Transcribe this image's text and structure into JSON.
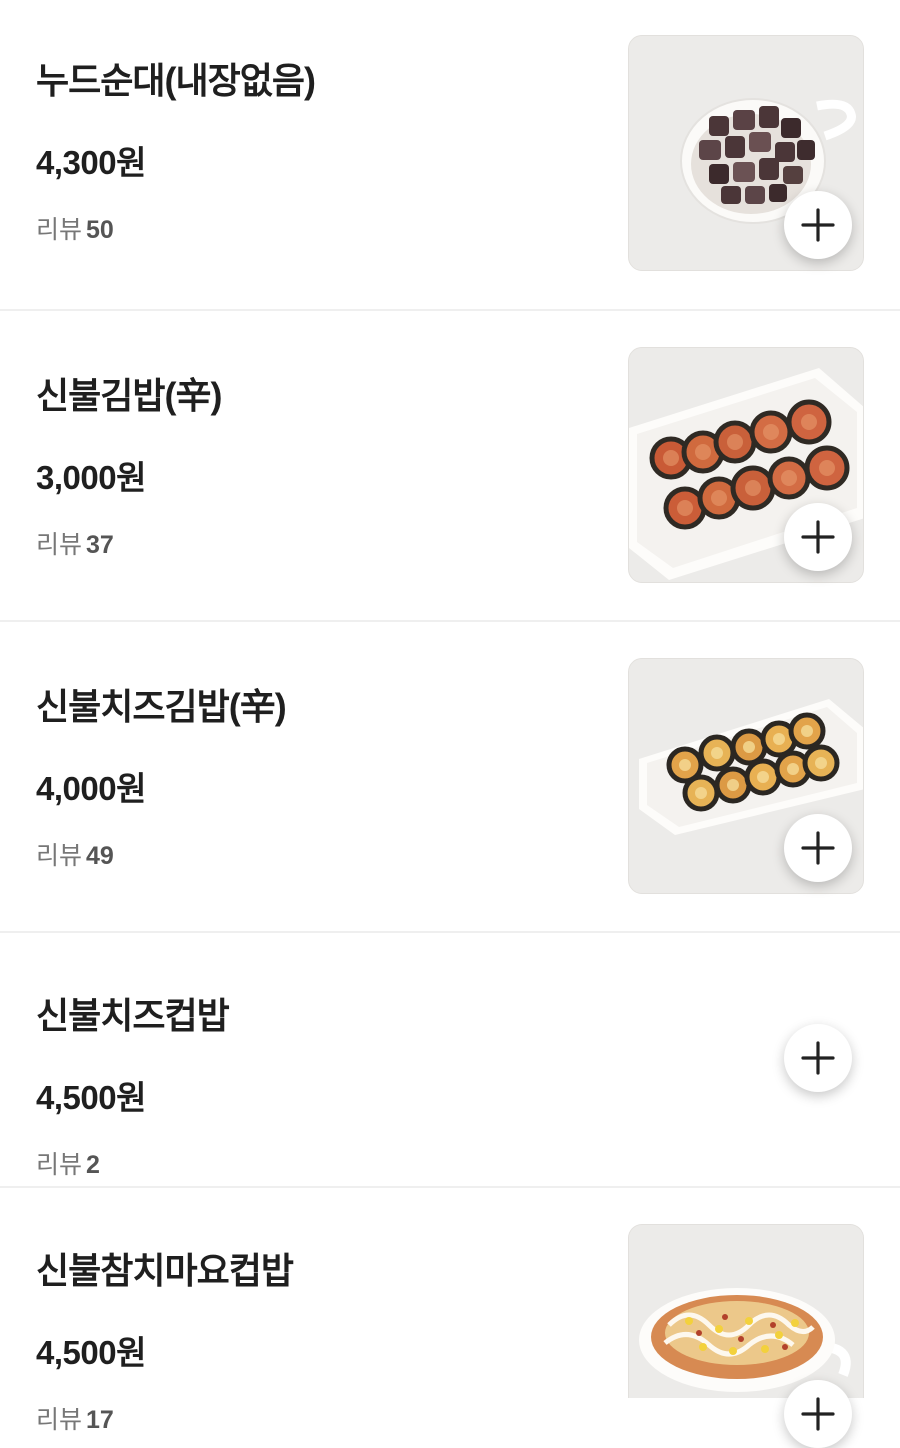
{
  "review_label": "리뷰",
  "items": [
    {
      "name": "누드순대(내장없음)",
      "price": "4,300원",
      "reviews": "50",
      "image": "soondae-photo"
    },
    {
      "name": "신불김밥(辛)",
      "price": "3,000원",
      "reviews": "37",
      "image": "spicy-gimbap-photo"
    },
    {
      "name": "신불치즈김밥(辛)",
      "price": "4,000원",
      "reviews": "49",
      "image": "spicy-cheese-gimbap-photo"
    },
    {
      "name": "신불치즈컵밥",
      "price": "4,500원",
      "reviews": "2",
      "image": null
    },
    {
      "name": "신불참치마요컵밥",
      "price": "4,500원",
      "reviews": "17",
      "image": "tuna-mayo-cupbap-photo"
    }
  ],
  "icons": {
    "add": "plus-icon"
  },
  "colors": {
    "text": "#1f1f1f",
    "muted": "#777777",
    "divider": "#efefef",
    "thumb_bg": "#ece9e5"
  }
}
